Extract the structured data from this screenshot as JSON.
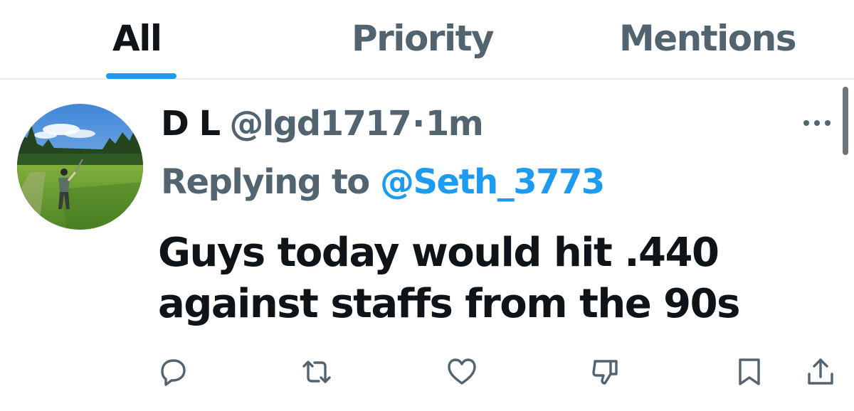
{
  "tabs": [
    {
      "label": "All",
      "active": true
    },
    {
      "label": "Priority",
      "active": false
    },
    {
      "label": "Mentions",
      "active": false
    }
  ],
  "tweet": {
    "display_name": "D L",
    "handle": "@lgd1717",
    "separator": "·",
    "time": "1m",
    "reply_prefix": "Replying to",
    "reply_handle": "@Seth_3773",
    "text": "Guys today would hit .440 against staffs from the 90s",
    "avatar_icon": "avatar-golfer-photo",
    "more_icon": "more-horizontal-icon",
    "actions": [
      {
        "name": "reply",
        "icon": "reply-icon"
      },
      {
        "name": "retweet",
        "icon": "retweet-icon"
      },
      {
        "name": "like",
        "icon": "heart-icon"
      },
      {
        "name": "dislike",
        "icon": "thumbs-down-icon"
      },
      {
        "name": "bookmark",
        "icon": "bookmark-icon"
      },
      {
        "name": "share",
        "icon": "share-icon"
      }
    ]
  },
  "colors": {
    "accent": "#1d9bf0",
    "text_primary": "#0f1419",
    "text_secondary": "#536471",
    "divider": "#e7e9ea"
  }
}
